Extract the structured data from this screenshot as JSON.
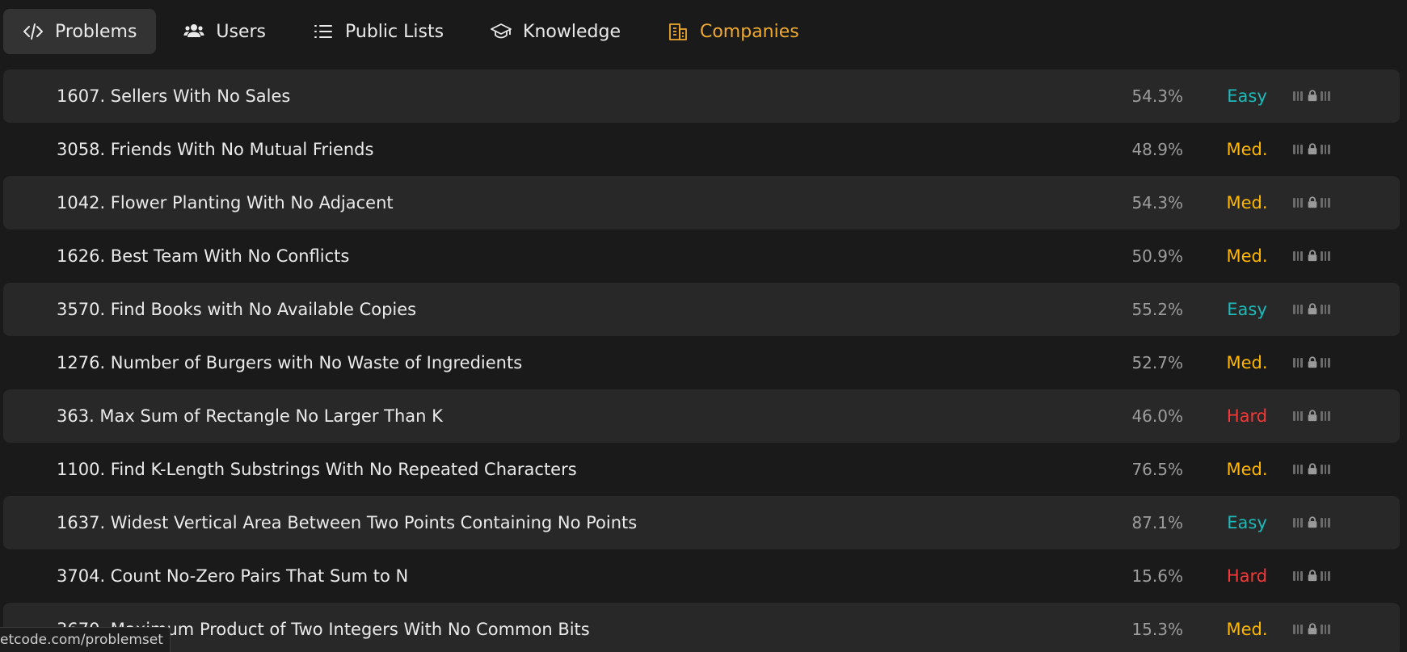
{
  "colors": {
    "brand": "#f0a92f",
    "easy": "#1cbaba",
    "medium": "#ffb700",
    "hard": "#f63737"
  },
  "nav": {
    "tabs": [
      {
        "label": "Problems",
        "icon": "code-icon"
      },
      {
        "label": "Users",
        "icon": "users-icon"
      },
      {
        "label": "Public Lists",
        "icon": "list-icon"
      },
      {
        "label": "Knowledge",
        "icon": "graduation-cap-icon"
      },
      {
        "label": "Companies",
        "icon": "building-icon"
      }
    ]
  },
  "problems": [
    {
      "title": "1607. Sellers With No Sales",
      "acceptance": "54.3%",
      "difficulty": "Easy"
    },
    {
      "title": "3058. Friends With No Mutual Friends",
      "acceptance": "48.9%",
      "difficulty": "Med."
    },
    {
      "title": "1042. Flower Planting With No Adjacent",
      "acceptance": "54.3%",
      "difficulty": "Med."
    },
    {
      "title": "1626. Best Team With No Conflicts",
      "acceptance": "50.9%",
      "difficulty": "Med."
    },
    {
      "title": "3570. Find Books with No Available Copies",
      "acceptance": "55.2%",
      "difficulty": "Easy"
    },
    {
      "title": "1276. Number of Burgers with No Waste of Ingredients",
      "acceptance": "52.7%",
      "difficulty": "Med."
    },
    {
      "title": "363. Max Sum of Rectangle No Larger Than K",
      "acceptance": "46.0%",
      "difficulty": "Hard"
    },
    {
      "title": "1100. Find K-Length Substrings With No Repeated Characters",
      "acceptance": "76.5%",
      "difficulty": "Med."
    },
    {
      "title": "1637. Widest Vertical Area Between Two Points Containing No Points",
      "acceptance": "87.1%",
      "difficulty": "Easy"
    },
    {
      "title": "3704. Count No-Zero Pairs That Sum to N",
      "acceptance": "15.6%",
      "difficulty": "Hard"
    },
    {
      "title": "3670. Maximum Product of Two Integers With No Common Bits",
      "acceptance": "15.3%",
      "difficulty": "Med."
    }
  ],
  "status_bar": {
    "url": "etcode.com/problemset"
  }
}
